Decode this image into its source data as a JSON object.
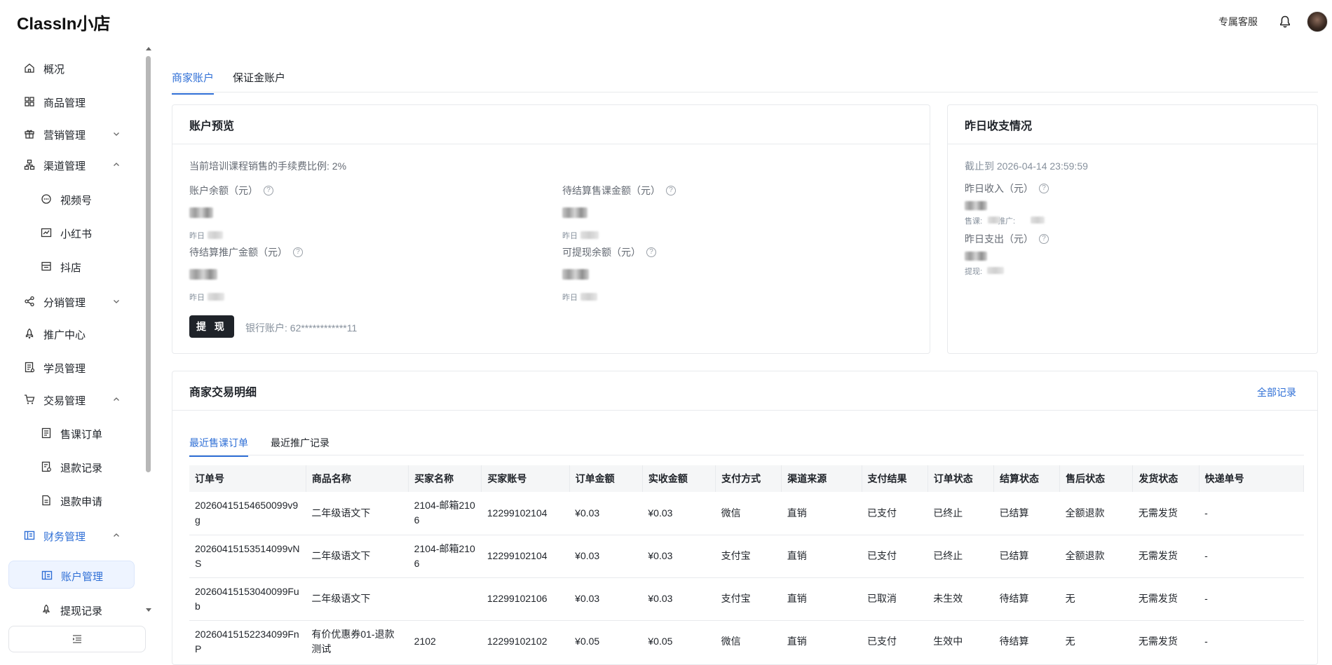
{
  "header": {
    "logo": "ClassIn小店",
    "service_link": "专属客服",
    "bell_icon": "bell-icon",
    "avatar_icon": "avatar"
  },
  "sidebar": {
    "items": [
      {
        "label": "概况",
        "icon": "home-icon"
      },
      {
        "label": "商品管理",
        "icon": "grid-icon"
      },
      {
        "label": "营销管理",
        "icon": "gift-icon",
        "chevron": "down"
      },
      {
        "label": "渠道管理",
        "icon": "channel-icon",
        "chevron": "up"
      },
      {
        "label": "视频号",
        "icon": "video-channel-icon"
      },
      {
        "label": "小红书",
        "icon": "chart-icon"
      },
      {
        "label": "抖店",
        "icon": "store-icon"
      },
      {
        "label": "分销管理",
        "icon": "share-icon",
        "chevron": "down"
      },
      {
        "label": "推广中心",
        "icon": "rocket-icon"
      },
      {
        "label": "学员管理",
        "icon": "student-icon"
      },
      {
        "label": "交易管理",
        "icon": "cart-icon",
        "chevron": "up"
      },
      {
        "label": "售课订单",
        "icon": "order-icon"
      },
      {
        "label": "退款记录",
        "icon": "refund-record-icon"
      },
      {
        "label": "退款申请",
        "icon": "refund-apply-icon"
      },
      {
        "label": "财务管理",
        "icon": "wallet-icon",
        "chevron": "up"
      },
      {
        "label": "账户管理",
        "icon": "account-icon"
      },
      {
        "label": "提现记录",
        "icon": "withdraw-icon"
      }
    ],
    "collapse_icon": "collapse-icon"
  },
  "tabs": [
    {
      "label": "商家账户"
    },
    {
      "label": "保证金账户"
    }
  ],
  "overview": {
    "title": "账户预览",
    "fee_ratio": "当前培训课程销售的手续费比例: 2%",
    "balance_label": "账户余额（元）",
    "pending_course_label": "待结算售课金额（元）",
    "pending_promo_label": "待结算推广金额（元）",
    "withdrawable_label": "可提现余额（元）",
    "yesterday_prefix": "昨日",
    "withdraw_button": "提 现",
    "bank_account": "银行账户: 62************11"
  },
  "yesterday": {
    "title": "昨日收支情况",
    "cutoff": "截止到 2026-04-14 23:59:59",
    "income_label": "昨日收入（元）",
    "income_detail_course": "售课:",
    "income_detail_promo": "推广:",
    "expense_label": "昨日支出（元）",
    "expense_detail": "提现:"
  },
  "transactions": {
    "title": "商家交易明细",
    "all_records": "全部记录",
    "subtabs": [
      {
        "label": "最近售课订单"
      },
      {
        "label": "最近推广记录"
      }
    ],
    "columns": [
      "订单号",
      "商品名称",
      "买家名称",
      "买家账号",
      "订单金额",
      "实收金额",
      "支付方式",
      "渠道来源",
      "支付结果",
      "订单状态",
      "结算状态",
      "售后状态",
      "发货状态",
      "快递单号"
    ],
    "rows": [
      [
        "20260415154650099v9g",
        "二年级语文下",
        "2104-邮箱2106",
        "12299102104",
        "¥0.03",
        "¥0.03",
        "微信",
        "直销",
        "已支付",
        "已终止",
        "已结算",
        "全额退款",
        "无需发货",
        "-"
      ],
      [
        "20260415153514099vNS",
        "二年级语文下",
        "2104-邮箱2106",
        "12299102104",
        "¥0.03",
        "¥0.03",
        "支付宝",
        "直销",
        "已支付",
        "已终止",
        "已结算",
        "全额退款",
        "无需发货",
        "-"
      ],
      [
        "20260415153040099Fub",
        "二年级语文下",
        "",
        "12299102106",
        "¥0.03",
        "¥0.03",
        "支付宝",
        "直销",
        "已取消",
        "未生效",
        "待结算",
        "无",
        "无需发货",
        "-"
      ],
      [
        "20260415152234099FnP",
        "有价优惠券01-退款测试",
        "2102",
        "12299102102",
        "¥0.05",
        "¥0.05",
        "微信",
        "直销",
        "已支付",
        "生效中",
        "待结算",
        "无",
        "无需发货",
        "-"
      ]
    ]
  }
}
